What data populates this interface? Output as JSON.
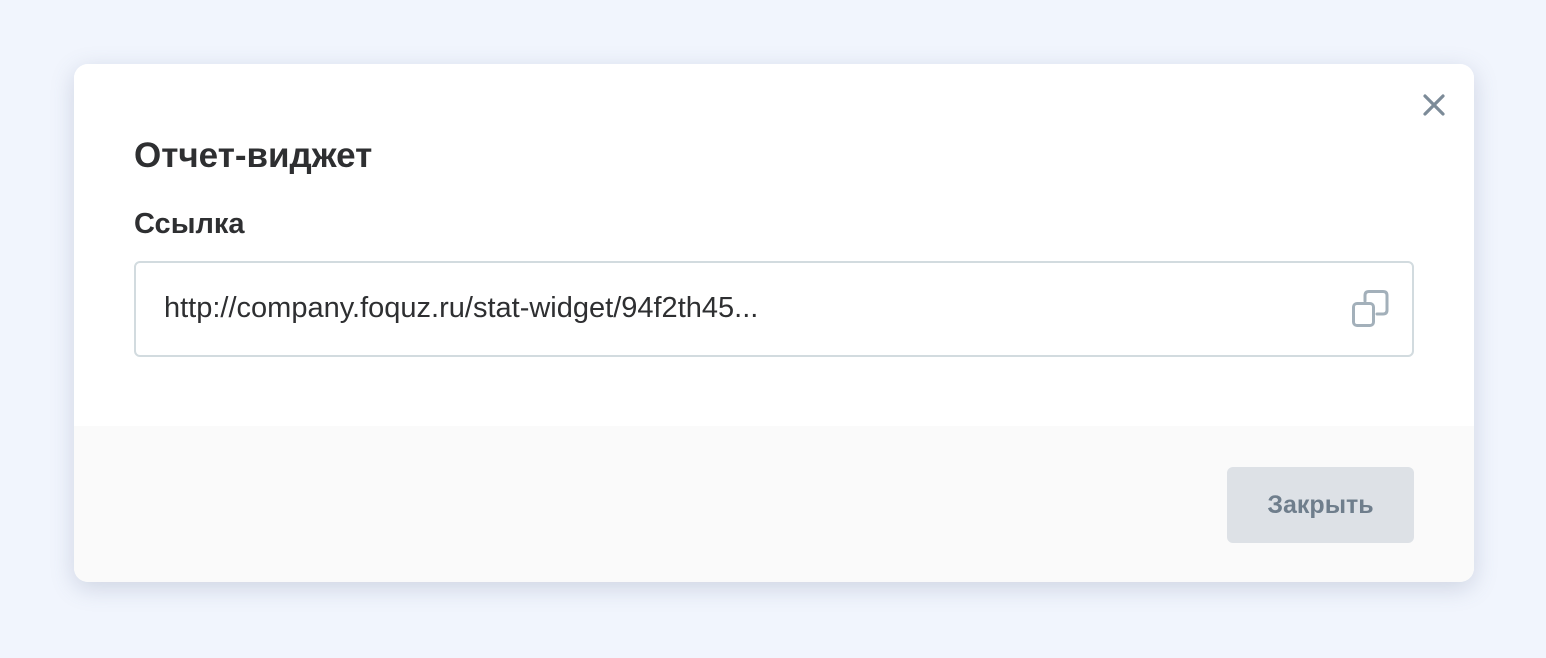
{
  "modal": {
    "title": "Отчет-виджет",
    "field_label": "Ссылка",
    "link_value": "http://company.foquz.ru/stat-widget/94f2th45...",
    "close_button_label": "Закрыть"
  },
  "icons": {
    "close": "close-icon",
    "copy": "copy-icon"
  },
  "colors": {
    "page_background": "#f1f5fd",
    "text_primary": "#2e2f31",
    "icon": "#7c8b98",
    "button_background": "#dde1e6",
    "button_text": "#6f7e8c",
    "footer_background": "#fafafa",
    "field_border": "#d2dbdf"
  }
}
